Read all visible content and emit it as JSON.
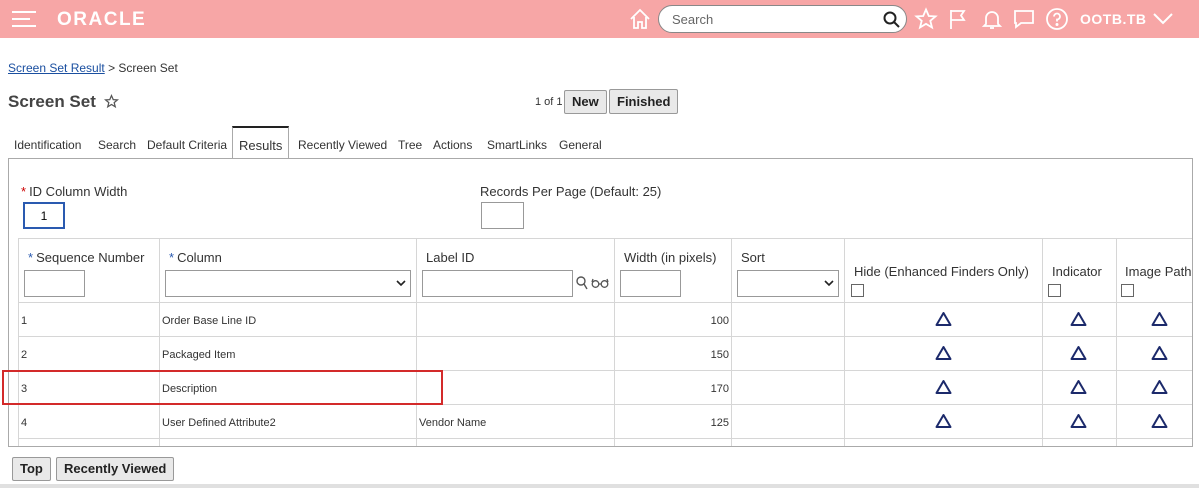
{
  "header": {
    "app_logo": "ORACLE",
    "search_placeholder": "Search",
    "user": "OOTB.TB",
    "colors": {
      "header_bg": "#f7a6a6",
      "icon": "#ffffff"
    }
  },
  "breadcrumb": {
    "link": "Screen Set Result",
    "separator": ">",
    "current": "Screen Set"
  },
  "page": {
    "title": "Screen Set",
    "pager": "1 of 1",
    "new_label": "New",
    "finished_label": "Finished"
  },
  "tabs": [
    {
      "label": "Identification"
    },
    {
      "label": "Search"
    },
    {
      "label": "Default Criteria"
    },
    {
      "label": "Results"
    },
    {
      "label": "Recently Viewed"
    },
    {
      "label": "Tree"
    },
    {
      "label": "Actions"
    },
    {
      "label": "SmartLinks"
    },
    {
      "label": "General"
    }
  ],
  "form": {
    "id_col_width_label": "ID Column Width",
    "id_col_width_value": "1",
    "records_per_page_label": "Records Per Page (Default: 25)",
    "records_per_page_value": ""
  },
  "table": {
    "columns": [
      "Sequence Number",
      "Column",
      "Label ID",
      "Width (in pixels)",
      "Sort",
      "Hide (Enhanced Finders Only)",
      "Indicator",
      "Image Path"
    ],
    "rows": [
      {
        "seq": "1",
        "column": "Order Base Line ID",
        "label_id": "",
        "width": "100"
      },
      {
        "seq": "2",
        "column": "Packaged Item",
        "label_id": "",
        "width": "150"
      },
      {
        "seq": "3",
        "column": "Description",
        "label_id": "",
        "width": "170"
      },
      {
        "seq": "4",
        "column": "User Defined Attribute2",
        "label_id": "Vendor Name",
        "width": "125"
      }
    ]
  },
  "footer": {
    "top_label": "Top",
    "recently_viewed_label": "Recently Viewed"
  }
}
